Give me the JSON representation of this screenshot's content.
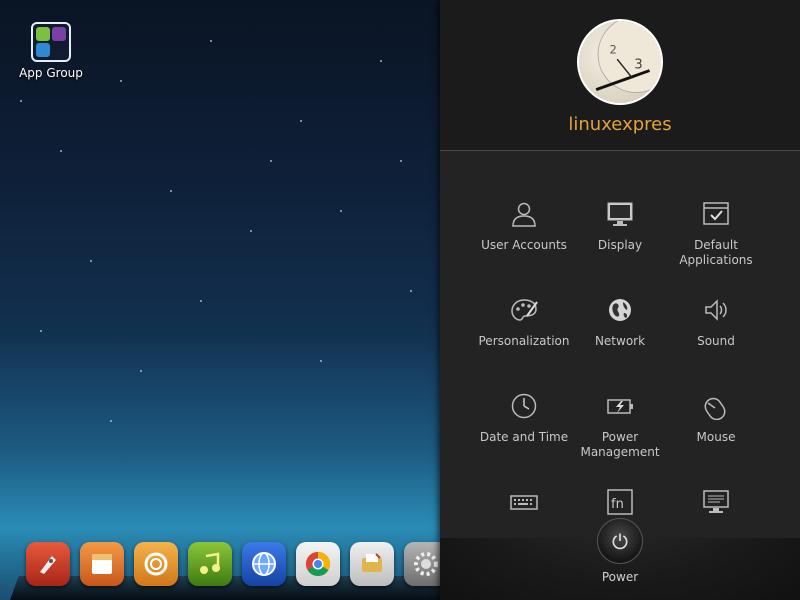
{
  "desktop": {
    "icons": [
      {
        "label": "App Group",
        "icon": "app-group-icon"
      }
    ]
  },
  "dock": {
    "apps": [
      {
        "name": "rocket-launcher-icon",
        "color": "#d9432a"
      },
      {
        "name": "store-icon",
        "color": "#e8772a"
      },
      {
        "name": "spiral-app-icon",
        "color": "#e8901e"
      },
      {
        "name": "music-player-icon",
        "color": "#6aa81e"
      },
      {
        "name": "browser-globe-icon",
        "color": "#1f5fd1"
      },
      {
        "name": "chrome-icon",
        "color": "#e8e8e8"
      },
      {
        "name": "file-manager-icon",
        "color": "#dcdcdc"
      },
      {
        "name": "settings-gear-icon",
        "color": "#8a8a8a"
      }
    ]
  },
  "panel": {
    "username": "linuxexpres",
    "accent": "#e2a33a",
    "items": [
      {
        "label": "User Accounts",
        "icon": "user-icon"
      },
      {
        "label": "Display",
        "icon": "monitor-icon"
      },
      {
        "label": "Default Applications",
        "icon": "default-apps-icon"
      },
      {
        "label": "Personalization",
        "icon": "palette-icon"
      },
      {
        "label": "Network",
        "icon": "globe-icon"
      },
      {
        "label": "Sound",
        "icon": "speaker-icon"
      },
      {
        "label": "Date and Time",
        "icon": "clock-icon"
      },
      {
        "label": "Power Management",
        "icon": "battery-icon"
      },
      {
        "label": "Mouse",
        "icon": "mouse-icon"
      },
      {
        "label": "",
        "icon": "keyboard-icon"
      },
      {
        "label": "",
        "icon": "fn-key-icon"
      },
      {
        "label": "",
        "icon": "system-info-icon"
      }
    ],
    "power_label": "Power"
  }
}
